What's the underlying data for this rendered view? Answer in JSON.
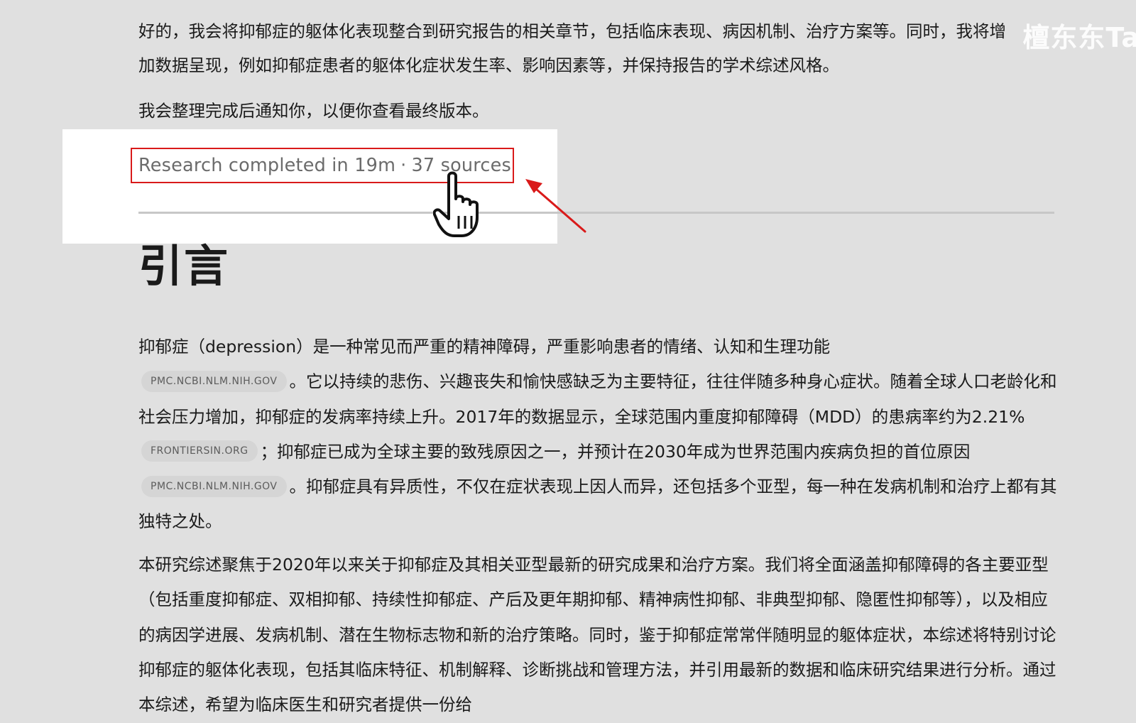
{
  "watermark": "檀东东Ta",
  "intro": {
    "p1": "好的，我会将抑郁症的躯体化表现整合到研究报告的相关章节，包括临床表现、病因机制、治疗方案等。同时，我将增加数据呈现，例如抑郁症患者的躯体化症状发生率、影响因素等，并保持报告的学术综述风格。",
    "p2": "我会整理完成后通知你，以便你查看最终版本。"
  },
  "research_status": {
    "completed": "Research completed in 19m",
    "separator": "·",
    "sources": "37 sources"
  },
  "section": {
    "title": "引言",
    "p1": {
      "a": "抑郁症（depression）是一种常见而严重的精神障碍，严重影响患者的情绪、认知和生理功能",
      "cite1": "PMC.NCBI.NLM.NIH.GOV",
      "b": "。它以持续的悲伤、兴趣丧失和愉快感缺乏为主要特征，往往伴随多种身心症状。随着全球人口老龄化和社会压力增加，抑郁症的发病率持续上升。2017年的数据显示，全球范围内重度抑郁障碍（MDD）的患病率约为2.21%",
      "cite2": "FRONTIERSIN.ORG",
      "c": "；抑郁症已成为全球主要的致残原因之一，并预计在2030年成为世界范围内疾病负担的首位原因",
      "cite3": "PMC.NCBI.NLM.NIH.GOV",
      "d": "。抑郁症具有异质性，不仅在症状表现上因人而异，还包括多个亚型，每一种在发病机制和治疗上都有其独特之处。"
    },
    "p2": "本研究综述聚焦于2020年以来关于抑郁症及其相关亚型最新的研究成果和治疗方案。我们将全面涵盖抑郁障碍的各主要亚型（包括重度抑郁症、双相抑郁、持续性抑郁症、产后及更年期抑郁、精神病性抑郁、非典型抑郁、隐匿性抑郁等），以及相应的病因学进展、发病机制、潜在生物标志物和新的治疗策略。同时，鉴于抑郁症常常伴随明显的躯体症状，本综述将特别讨论抑郁症的躯体化表现，包括其临床特征、机制解释、诊断挑战和管理方法，并引用最新的数据和临床研究结果进行分析。通过本综述，希望为临床医生和研究者提供一份给"
  },
  "colors": {
    "background": "#e0e0e0",
    "highlight_panel": "#ffffff",
    "annotation_red": "#d91a1a",
    "citation_chip": "#d5d5d5"
  },
  "icons": [
    "hand-pointer-cursor-icon",
    "annotation-arrow-icon"
  ]
}
